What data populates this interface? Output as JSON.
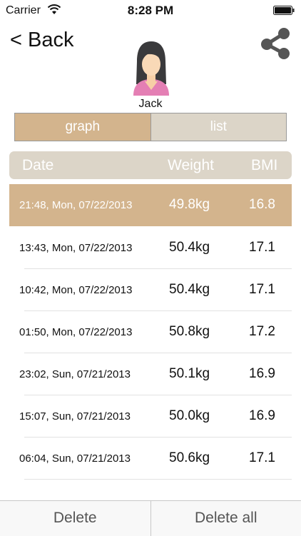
{
  "status_bar": {
    "carrier": "Carrier",
    "time": "8:28 PM"
  },
  "nav": {
    "back_label": "< Back",
    "share_icon": "share-icon"
  },
  "profile": {
    "name": "Jack",
    "avatar_icon": "female-avatar-icon"
  },
  "segments": {
    "graph": "graph",
    "list": "list",
    "selected": "graph"
  },
  "table": {
    "headers": {
      "date": "Date",
      "weight": "Weight",
      "bmi": "BMI"
    },
    "rows": [
      {
        "date": "21:48, Mon, 07/22/2013",
        "weight": "49.8kg",
        "bmi": "16.8"
      },
      {
        "date": "13:43, Mon, 07/22/2013",
        "weight": "50.4kg",
        "bmi": "17.1"
      },
      {
        "date": "10:42, Mon, 07/22/2013",
        "weight": "50.4kg",
        "bmi": "17.1"
      },
      {
        "date": "01:50, Mon, 07/22/2013",
        "weight": "50.8kg",
        "bmi": "17.2"
      },
      {
        "date": "23:02, Sun, 07/21/2013",
        "weight": "50.1kg",
        "bmi": "16.9"
      },
      {
        "date": "15:07, Sun, 07/21/2013",
        "weight": "50.0kg",
        "bmi": "16.9"
      },
      {
        "date": "06:04, Sun, 07/21/2013",
        "weight": "50.6kg",
        "bmi": "17.1"
      }
    ]
  },
  "actions": {
    "delete": "Delete",
    "delete_all": "Delete all"
  },
  "colors": {
    "accent": "#d3b48d",
    "muted": "#dcd5c8"
  }
}
